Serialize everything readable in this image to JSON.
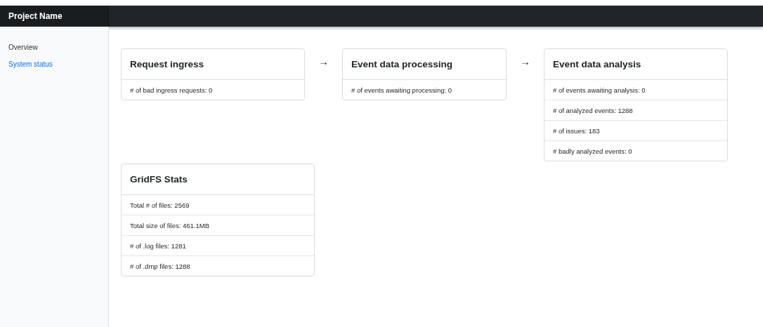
{
  "navbar": {
    "brand": "Project Name"
  },
  "sidebar": {
    "items": [
      {
        "label": "Overview",
        "selected": false
      },
      {
        "label": "System status",
        "selected": true
      }
    ]
  },
  "pipeline": [
    {
      "title": "Request ingress",
      "rows": [
        "# of bad ingress requests: 0"
      ]
    },
    {
      "arrow": "→",
      "title": "Event data processing",
      "rows": [
        "# of events awaiting processing: 0"
      ]
    },
    {
      "arrow": "→",
      "title": "Event data analysis",
      "rows": [
        "# of events awaiting analysis: 0",
        "# of analyzed events: 1288",
        "# of issues: 183",
        "# badly analyzed events: 0"
      ]
    }
  ],
  "gridfs": {
    "title": "GridFS Stats",
    "rows": [
      "Total # of files: 2569",
      "Total size of files: 461.1MB",
      "# of .log files: 1281",
      "# of .dmp files: 1288"
    ]
  }
}
